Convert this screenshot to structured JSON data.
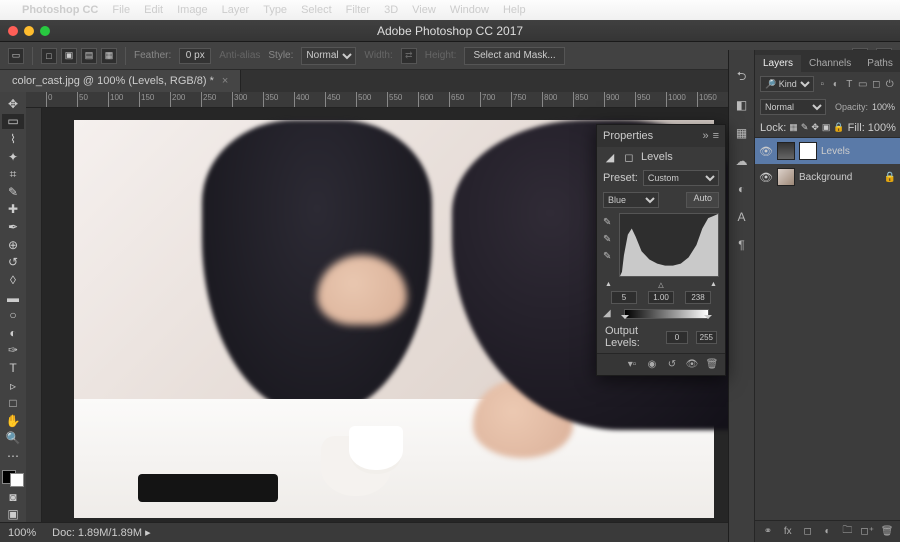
{
  "menubar": {
    "items": [
      "Photoshop CC",
      "File",
      "Edit",
      "Image",
      "Layer",
      "Type",
      "Select",
      "Filter",
      "3D",
      "View",
      "Window",
      "Help"
    ]
  },
  "window": {
    "title": "Adobe Photoshop CC 2017"
  },
  "options": {
    "feather_label": "Feather:",
    "feather_value": "0 px",
    "antialias": "Anti-alias",
    "style_label": "Style:",
    "style_value": "Normal",
    "width_label": "Width:",
    "height_label": "Height:",
    "select_mask": "Select and Mask..."
  },
  "document": {
    "tab": "color_cast.jpg @ 100% (Levels, RGB/8) *"
  },
  "ruler_ticks": [
    "0",
    "50",
    "100",
    "150",
    "200",
    "250",
    "300",
    "350",
    "400",
    "450",
    "500",
    "550",
    "600",
    "650",
    "700",
    "750",
    "800",
    "850",
    "900",
    "950",
    "1000",
    "1050"
  ],
  "tools": [
    "↖",
    "▭",
    "◌",
    "✂",
    "✎",
    "↩",
    "✒",
    "✚",
    "⌫",
    "◔",
    "△",
    "◧",
    "●",
    "T",
    "▹",
    "✥",
    "☰",
    "⤢",
    "⊡",
    "···"
  ],
  "properties": {
    "title": "Properties",
    "type": "Levels",
    "preset_label": "Preset:",
    "preset_value": "Custom",
    "channel": "Blue",
    "auto": "Auto",
    "input": {
      "black": "5",
      "mid": "1.00",
      "white": "238"
    },
    "output_label": "Output Levels:",
    "output": {
      "black": "0",
      "white": "255"
    }
  },
  "layers": {
    "tabs": [
      "Layers",
      "Channels",
      "Paths"
    ],
    "kind": "Kind",
    "blend": "Normal",
    "opacity_label": "Opacity:",
    "opacity": "100%",
    "lock_label": "Lock:",
    "fill_label": "Fill:",
    "fill": "100%",
    "items": [
      {
        "name": "Levels",
        "selected": true,
        "mask": true,
        "locked": false
      },
      {
        "name": "Background",
        "selected": false,
        "mask": false,
        "locked": true
      }
    ]
  },
  "status": {
    "zoom": "100%",
    "doc_label": "Doc:",
    "doc": "1.89M/1.89M"
  }
}
